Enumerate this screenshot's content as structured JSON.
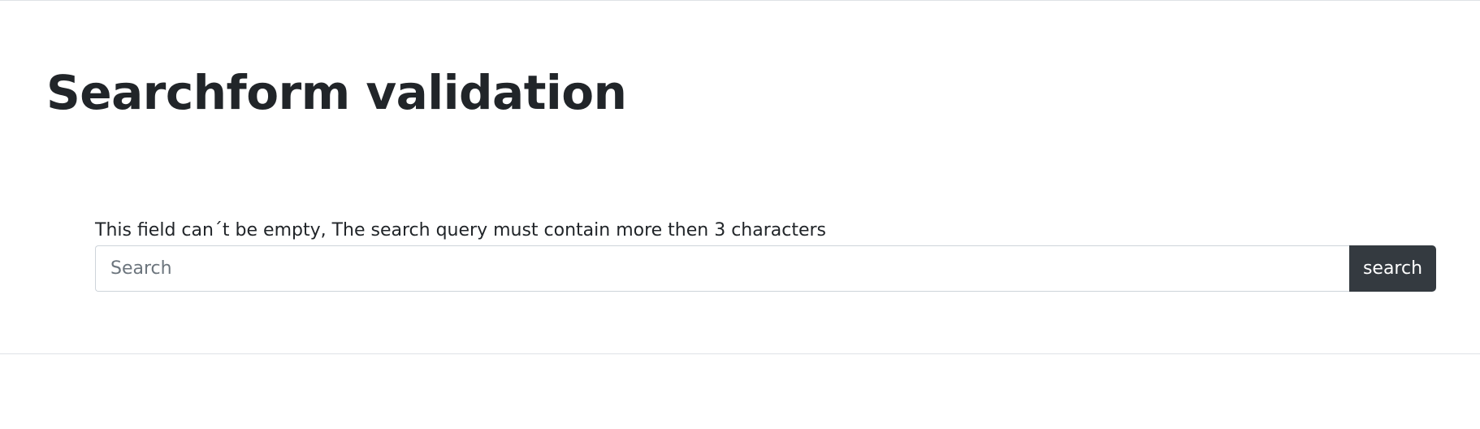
{
  "page": {
    "title": "Searchform validation"
  },
  "search_form": {
    "validation_message": "This field can´t be empty, The search query must contain more then 3 characters",
    "input": {
      "value": "",
      "placeholder": "Search"
    },
    "button_label": "search"
  },
  "colors": {
    "text": "#212529",
    "button_bg": "#343a40",
    "button_text": "#ffffff",
    "input_border": "#ced4da",
    "placeholder": "#6c757d",
    "rule": "#dee2e6"
  }
}
